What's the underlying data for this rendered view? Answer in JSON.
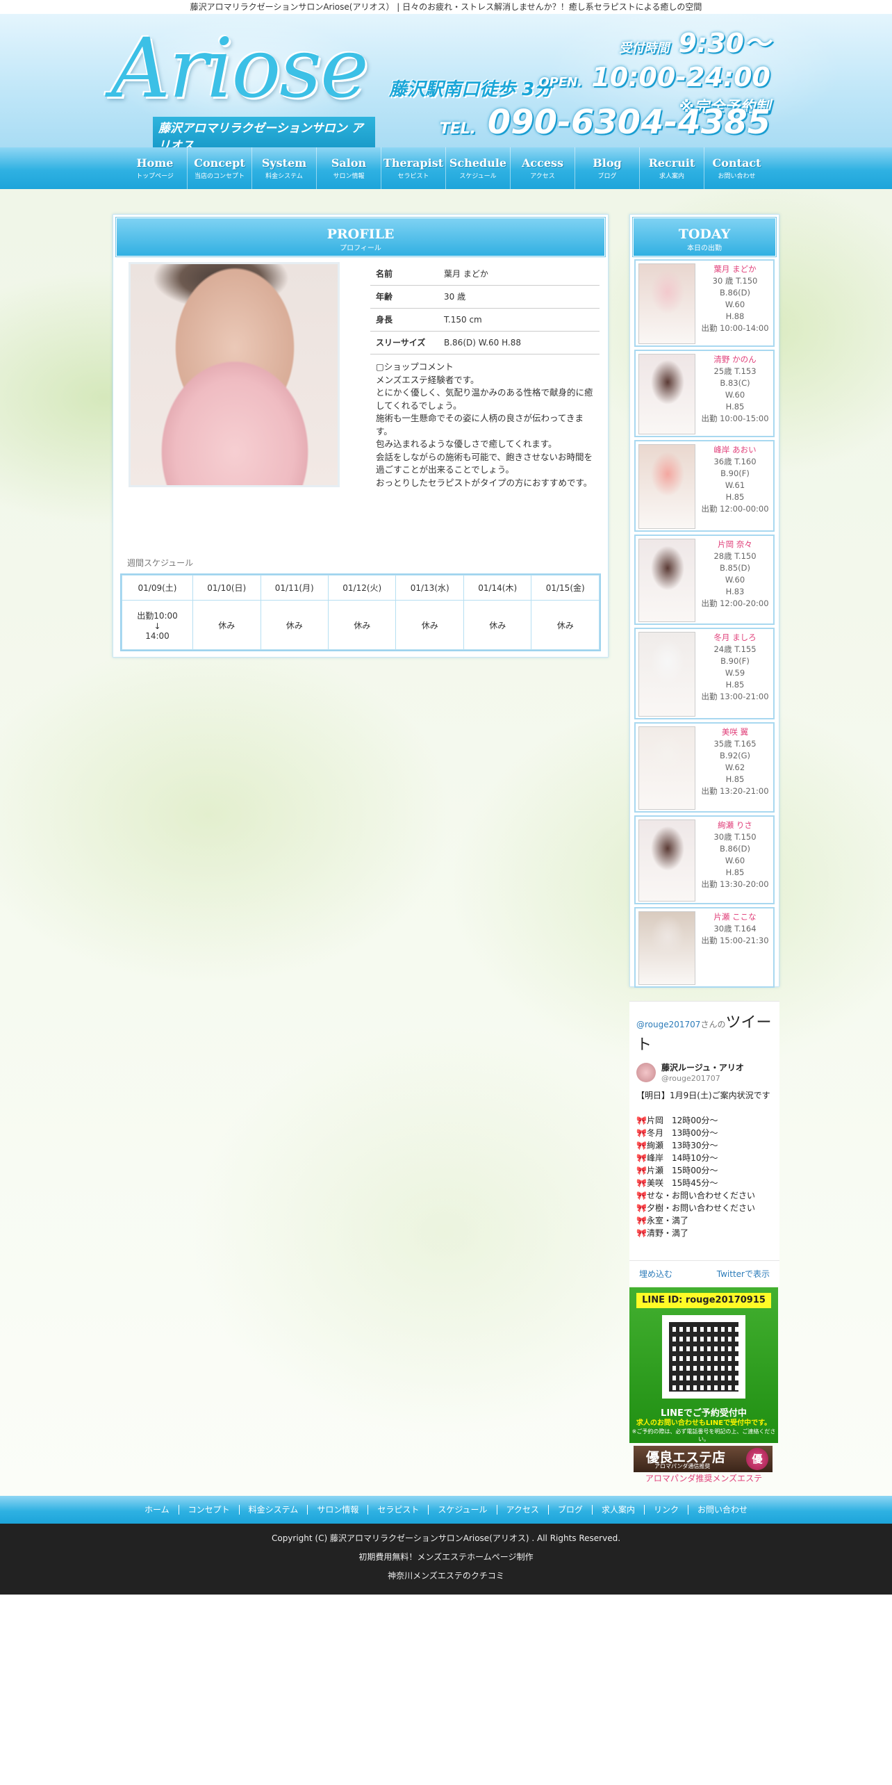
{
  "topline": "藤沢アロマリラクゼーションサロンAriose(アリオス） | 日々のお疲れ・ストレス解消しませんか？！癒し系セラピストによる癒しの空間",
  "header": {
    "logo": "Ariose",
    "logo_sub": "藤沢アロマリラクゼーションサロン アリオス",
    "station": "藤沢駅南口徒歩 3分",
    "reception_label": "受付時間",
    "reception_time": "9:30〜",
    "open_label": "OPEN.",
    "open_time": "10:00-24:00",
    "reservation": "※完全予約制",
    "tel_label": "TEL.",
    "tel": "090-6304-4385"
  },
  "nav": [
    {
      "en": "Home",
      "jp": "トップページ"
    },
    {
      "en": "Concept",
      "jp": "当店のコンセプト"
    },
    {
      "en": "System",
      "jp": "料金システム"
    },
    {
      "en": "Salon",
      "jp": "サロン情報"
    },
    {
      "en": "Therapist",
      "jp": "セラピスト"
    },
    {
      "en": "Schedule",
      "jp": "スケジュール"
    },
    {
      "en": "Access",
      "jp": "アクセス"
    },
    {
      "en": "Blog",
      "jp": "ブログ"
    },
    {
      "en": "Recruit",
      "jp": "求人案内"
    },
    {
      "en": "Contact",
      "jp": "お問い合わせ"
    }
  ],
  "profile": {
    "title": "PROFILE",
    "subtitle": "プロフィール",
    "rows": [
      {
        "k": "名前",
        "v": "葉月 まどか"
      },
      {
        "k": "年齢",
        "v": "30 歳"
      },
      {
        "k": "身長",
        "v": "T.150 cm"
      },
      {
        "k": "スリーサイズ",
        "v": "B.86(D) W.60 H.88"
      }
    ],
    "comment_title": "▢ショップコメント",
    "comment": [
      "メンズエステ経験者です。",
      "とにかく優しく、気配り温かみのある性格で献身的に癒してくれるでしょう。",
      "施術も一生懸命でその姿に人柄の良さが伝わってきます。",
      "包み込まれるような優しさで癒してくれます。",
      "会話をしながらの施術も可能で、飽きさせないお時間を過ごすことが出来ることでしょう。",
      "おっとりしたセラピストがタイプの方におすすめです。"
    ],
    "week_title": "週間スケジュール",
    "week_dates": [
      "01/09(土)",
      "01/10(日)",
      "01/11(月)",
      "01/12(火)",
      "01/13(水)",
      "01/14(木)",
      "01/15(金)"
    ],
    "week_first": [
      "出勤10:00",
      "↓",
      "14:00"
    ],
    "week_rest": [
      "休み",
      "休み",
      "休み",
      "休み",
      "休み",
      "休み"
    ]
  },
  "today": {
    "title": "TODAY",
    "subtitle": "本日の出勤",
    "casts": [
      {
        "name": "葉月 まどか",
        "lines": [
          "30 歳 T.150",
          "B.86(D)",
          "W.60",
          "H.88",
          "出勤 10:00-14:00"
        ]
      },
      {
        "name": "清野 かのん",
        "lines": [
          "25歳 T.153",
          "B.83(C)",
          "W.60",
          "H.85",
          "出勤 10:00-15:00"
        ]
      },
      {
        "name": "峰岸 あおい",
        "lines": [
          "36歳 T.160",
          "B.90(F)",
          "W.61",
          "H.85",
          "出勤 12:00-00:00"
        ]
      },
      {
        "name": "片岡 奈々",
        "lines": [
          "28歳 T.150",
          "B.85(D)",
          "W.60",
          "H.83",
          "出勤 12:00-20:00"
        ]
      },
      {
        "name": "冬月 ましろ",
        "lines": [
          "24歳 T.155",
          "B.90(F)",
          "W.59",
          "H.85",
          "出勤 13:00-21:00"
        ]
      },
      {
        "name": "美咲 翼",
        "lines": [
          "35歳 T.165",
          "B.92(G)",
          "W.62",
          "H.85",
          "出勤 13:20-21:00"
        ]
      },
      {
        "name": "絢瀬 りさ",
        "lines": [
          "30歳 T.150",
          "B.86(D)",
          "W.60",
          "H.85",
          "出勤 13:30-20:00"
        ]
      },
      {
        "name": "片瀬 ここな",
        "lines": [
          "30歳 T.164",
          "出勤 15:00-21:30"
        ]
      }
    ]
  },
  "twitter": {
    "handle_link": "@rouge201707",
    "handle_suffix": "さんの",
    "heading": "ツイート",
    "user_name": "藤沢ルージュ・アリオ",
    "user_handle": "@rouge201707",
    "body": [
      "【明日】1月9日(土)ご案内状況です",
      "",
      "🎀片岡　12時00分〜",
      "🎀冬月　13時00分〜",
      "🎀絢瀬　13時30分～",
      "🎀峰岸　14時10分～",
      "🎀片瀬　15時00分～",
      "🎀美咲　15時45分～",
      "🎀せな・お問い合わせください",
      "🎀夕樹・お問い合わせください",
      "🎀永室・満了",
      "🎀清野・満了"
    ],
    "embed": "埋め込む",
    "view": "Twitterで表示"
  },
  "line": {
    "id": "LINE ID:  rouge20170915",
    "t1": "LINEでご予約受付中",
    "t2": "求人のお問い合わせもLINEで受付中です。",
    "t3": "※ご予約の際は、必ず電話番号を明記の上、ご連絡ください。"
  },
  "banner": {
    "title": "優良エステ店",
    "sub": "アロマパンダ通信推奨",
    "seal": "優",
    "caption": "アロマパンダ推奨メンズエステ"
  },
  "footer_nav": [
    "ホーム",
    "コンセプト",
    "料金システム",
    "サロン情報",
    "セラピスト",
    "スケジュール",
    "アクセス",
    "ブログ",
    "求人案内",
    "リンク",
    "お問い合わせ"
  ],
  "footer": {
    "copyright": "Copyright (C) 藤沢アロマリラクゼーションサロンAriose(アリオス) . All Rights Reserved.",
    "line2": "初期費用無料！メンズエステホームページ制作",
    "line3": "神奈川メンズエステのクチコミ"
  }
}
